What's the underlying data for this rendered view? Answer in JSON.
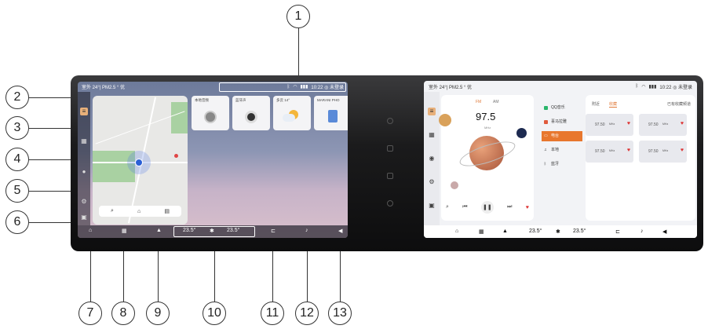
{
  "callouts": [
    "1",
    "2",
    "3",
    "4",
    "5",
    "6",
    "7",
    "8",
    "9",
    "10",
    "11",
    "12",
    "13"
  ],
  "left_screen": {
    "status_left": "室外 24°| PM2.5 ° 优",
    "status_right": "10:22 ◎ 未登录",
    "widgets": [
      {
        "label": "本地音频"
      },
      {
        "label": "蓝牙声"
      },
      {
        "label": "多云 14°"
      },
      {
        "label": "MARANI PHO"
      }
    ],
    "dock": {
      "temp_left": "23.5°",
      "temp_right": "23.5°"
    }
  },
  "right_screen": {
    "status_left": "室外 24°| PM2.5 ° 优",
    "status_right": "10:22 ◎ 未登录",
    "radio": {
      "tab_fm": "FM",
      "tab_am": "AM",
      "frequency": "97.5",
      "unit": "MHz"
    },
    "menu": [
      "QQ音乐",
      "喜马拉雅",
      "电台",
      "本地",
      "蓝牙"
    ],
    "tabs": {
      "tab1": "附近",
      "tab2": "收藏",
      "action": "已有收藏频道"
    },
    "favorites": [
      {
        "freq": "97.50",
        "unit": "MHz"
      },
      {
        "freq": "97.50",
        "unit": "MHz"
      },
      {
        "freq": "97.50",
        "unit": "MHz"
      },
      {
        "freq": "97.50",
        "unit": "MHz"
      }
    ],
    "dock": {
      "temp_left": "23.5°",
      "temp_right": "23.5°"
    }
  }
}
